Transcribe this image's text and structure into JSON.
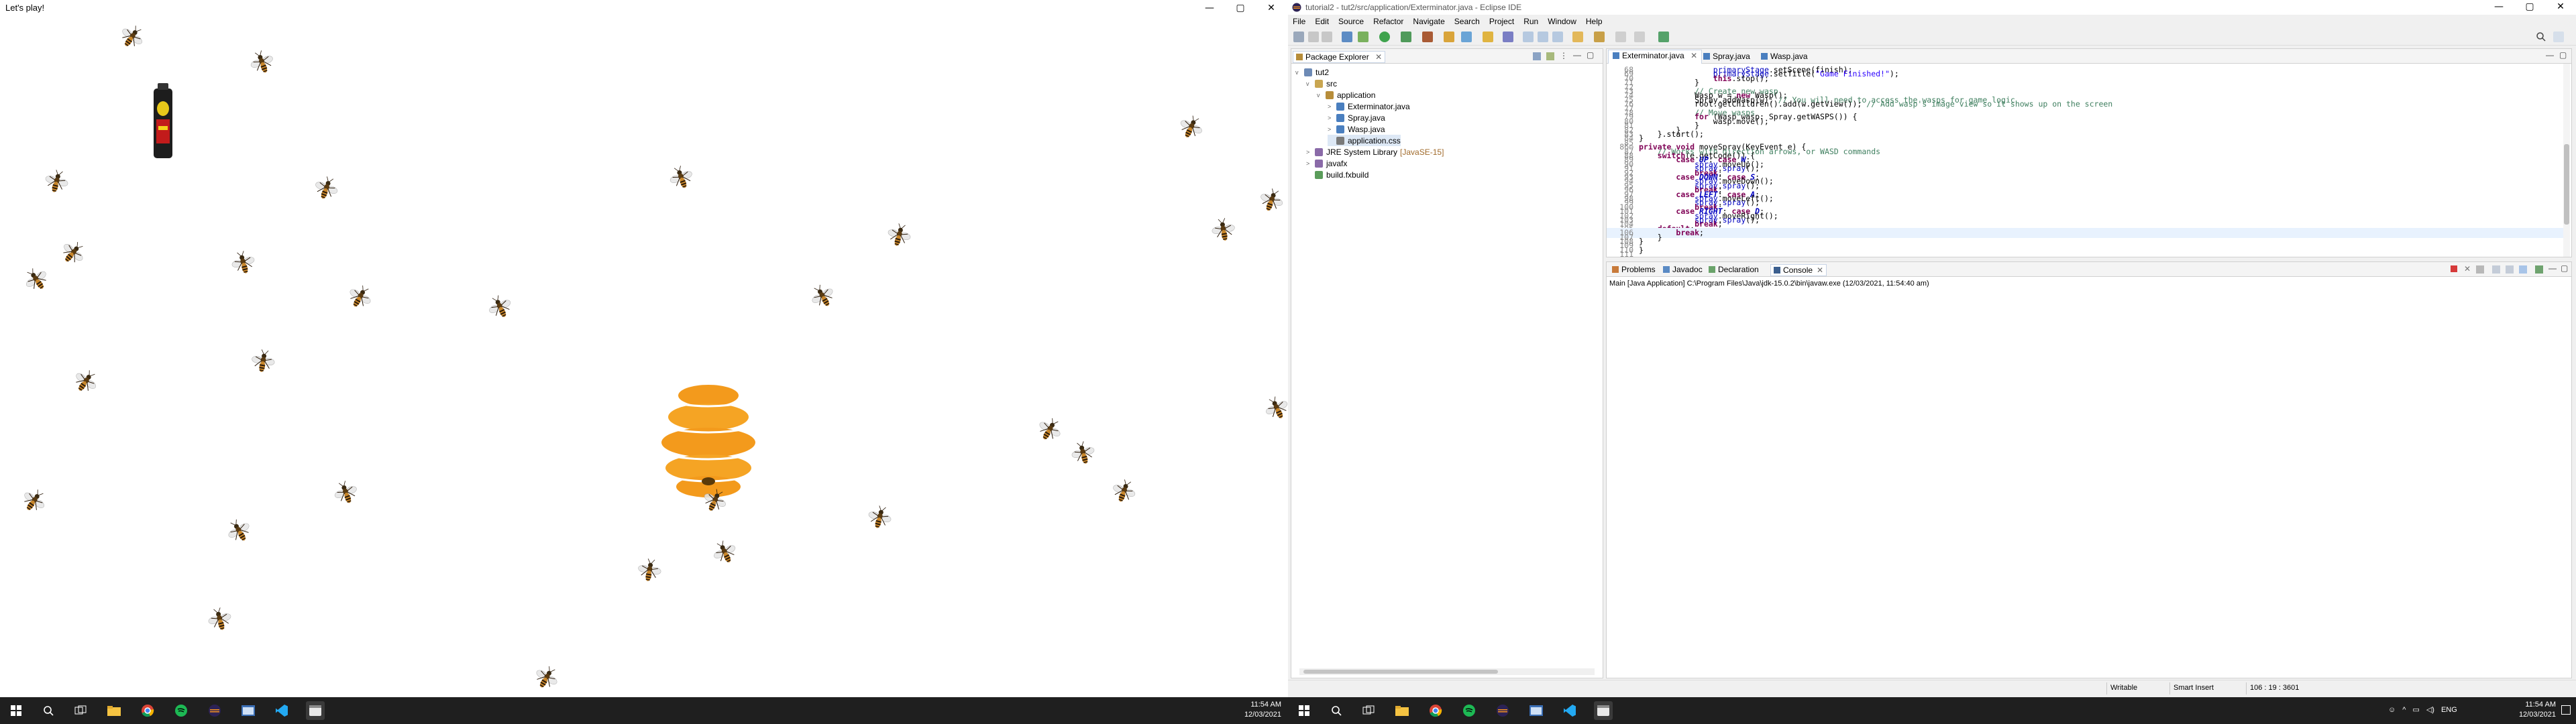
{
  "left": {
    "game_title": "Let's play!",
    "win_min": "—",
    "win_max": "▢",
    "win_close": "✕"
  },
  "right": {
    "title": "tutorial2 - tut2/src/application/Exterminator.java - Eclipse IDE",
    "win_min": "—",
    "win_max": "▢",
    "win_close": "✕",
    "menu": [
      "File",
      "Edit",
      "Source",
      "Refactor",
      "Navigate",
      "Search",
      "Project",
      "Run",
      "Window",
      "Help"
    ],
    "package_explorer": {
      "tab_label": "Package Explorer",
      "tree": [
        {
          "label": "tut2",
          "indent": 0,
          "twisty": "v",
          "icon": "project-icon",
          "color": "#6d8ab5"
        },
        {
          "label": "src",
          "indent": 1,
          "twisty": "v",
          "icon": "source-folder-icon",
          "color": "#c9a651"
        },
        {
          "label": "application",
          "indent": 2,
          "twisty": "v",
          "icon": "package-icon",
          "color": "#b78d3a"
        },
        {
          "label": "Exterminator.java",
          "indent": 3,
          "twisty": ">",
          "icon": "java-file-icon",
          "color": "#4a7fbf"
        },
        {
          "label": "Spray.java",
          "indent": 3,
          "twisty": ">",
          "icon": "java-file-icon",
          "color": "#4a7fbf"
        },
        {
          "label": "Wasp.java",
          "indent": 3,
          "twisty": ">",
          "icon": "java-file-icon",
          "color": "#4a7fbf"
        },
        {
          "label": "application.css",
          "indent": 3,
          "twisty": "",
          "icon": "css-file-icon",
          "color": "#7a7a7a",
          "selected": true
        },
        {
          "label": "JRE System Library",
          "suffix": "[JavaSE-15]",
          "indent": 1,
          "twisty": ">",
          "icon": "library-icon",
          "color": "#8a6aa8"
        },
        {
          "label": "javafx",
          "indent": 1,
          "twisty": ">",
          "icon": "library-icon",
          "color": "#8a6aa8"
        },
        {
          "label": "build.fxbuild",
          "indent": 1,
          "twisty": "",
          "icon": "fxbuild-file-icon",
          "color": "#5a9c5a"
        }
      ]
    },
    "editor": {
      "tabs": [
        "Exterminator.java",
        "Spray.java",
        "Wasp.java"
      ],
      "active_tab": 0,
      "lines": [
        {
          "n": "68",
          "t": "                primaryStage.setScene(finish);"
        },
        {
          "n": "69",
          "t": "                primaryStage.setTitle(\"Game Finished!\");"
        },
        {
          "n": "70",
          "t": "                this.stop();"
        },
        {
          "n": "71",
          "t": "            }"
        },
        {
          "n": "72",
          "t": ""
        },
        {
          "n": "73",
          "t": "            // Create new wasp"
        },
        {
          "n": "74",
          "t": "            Wasp w = new Wasp();"
        },
        {
          "n": "75",
          "t": "            Spray.addWasp(w); // You will need to access the wasps for game logic"
        },
        {
          "n": "76",
          "t": "            root.getChildren().add(w.getView()); // Add wasp's image view so it shows up on the screen"
        },
        {
          "n": "77",
          "t": ""
        },
        {
          "n": "78",
          "t": "            // Move wasps"
        },
        {
          "n": "79",
          "t": "            for (Wasp wasp: Spray.getWASPS()) {"
        },
        {
          "n": "80",
          "t": "                wasp.move();"
        },
        {
          "n": "81",
          "t": "            }"
        },
        {
          "n": "82",
          "t": "        }"
        },
        {
          "n": "83",
          "t": "    }.start();"
        },
        {
          "n": "84",
          "t": "}"
        },
        {
          "n": "85",
          "t": ""
        },
        {
          "n": "86⊖",
          "t": "private void moveSpray(KeyEvent e) {"
        },
        {
          "n": "87",
          "t": "    // Works with direction arrows, or WASD commands"
        },
        {
          "n": "88",
          "t": "    switch(e.getCode()) {"
        },
        {
          "n": "89",
          "t": "        case UP: case W:"
        },
        {
          "n": "90",
          "t": "            spray.moveUp();"
        },
        {
          "n": "91",
          "t": "            spray.spray();"
        },
        {
          "n": "92",
          "t": "            break;"
        },
        {
          "n": "93",
          "t": "        case DOWN: case S:"
        },
        {
          "n": "94",
          "t": "            spray.moveDown();"
        },
        {
          "n": "95",
          "t": "            spray.spray();"
        },
        {
          "n": "96",
          "t": "            break;"
        },
        {
          "n": "97",
          "t": "        case LEFT: case A:"
        },
        {
          "n": "98",
          "t": "            spray.moveLeft();"
        },
        {
          "n": "99",
          "t": "            spray.spray();"
        },
        {
          "n": "100",
          "t": "            break;"
        },
        {
          "n": "101",
          "t": "        case RIGHT: case D:"
        },
        {
          "n": "102",
          "t": "            spray.moveRight();"
        },
        {
          "n": "103",
          "t": "            spray.spray();"
        },
        {
          "n": "104",
          "t": "            break;"
        },
        {
          "n": "105",
          "t": "    default:"
        },
        {
          "n": "106",
          "t": "        break;"
        },
        {
          "n": "107",
          "t": "    }"
        },
        {
          "n": "108",
          "t": "}"
        },
        {
          "n": "109",
          "t": ""
        },
        {
          "n": "110",
          "t": "}"
        },
        {
          "n": "111",
          "t": ""
        }
      ]
    },
    "console": {
      "tabs": [
        "Problems",
        "Javadoc",
        "Declaration",
        "Console"
      ],
      "active_tab": 3,
      "text": "Main [Java Application] C:\\Program Files\\Java\\jdk-15.0.2\\bin\\javaw.exe (12/03/2021, 11:54:40 am)"
    },
    "status": {
      "writable": "Writable",
      "insert_mode": "Smart Insert",
      "position": "106 : 19 : 3601"
    }
  },
  "taskbar": {
    "time": "11:54 AM",
    "date": "12/03/2021",
    "lang": "ENG"
  }
}
